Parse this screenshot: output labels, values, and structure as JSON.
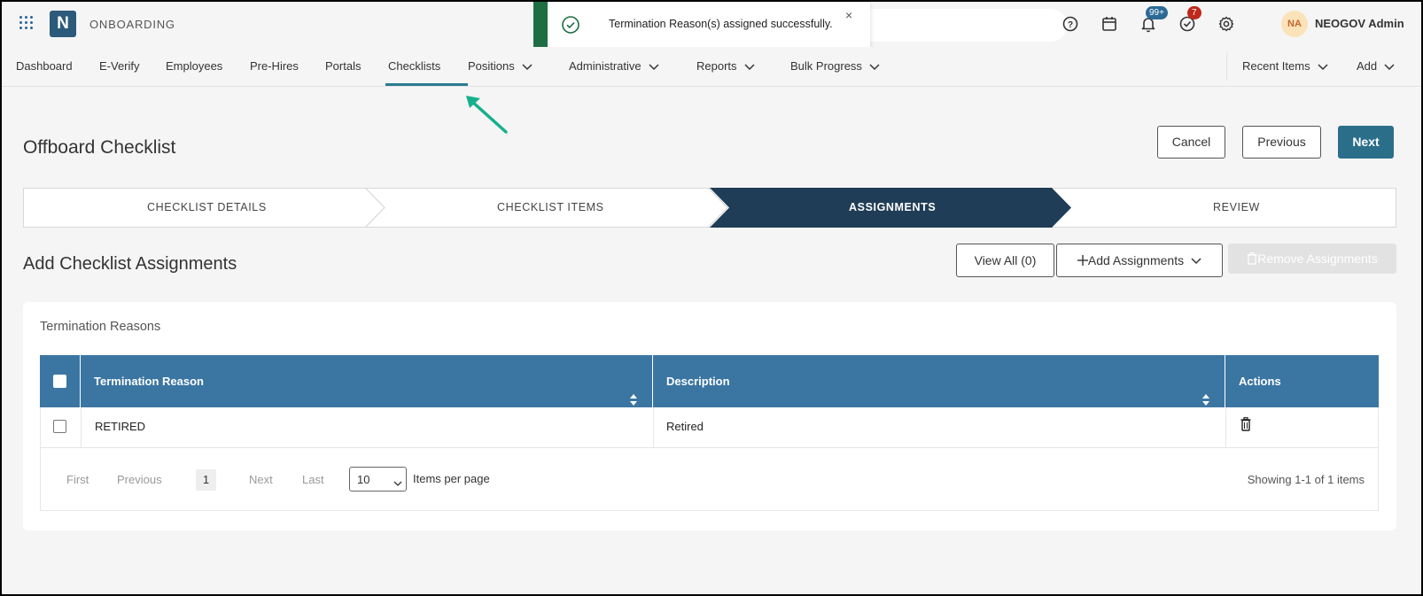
{
  "app": {
    "name": "ONBOARDING",
    "logo_letter": "N"
  },
  "header": {
    "notifications_badge": "99+",
    "tasks_badge": "7",
    "user_initials": "NA",
    "user_name": "NEOGOV Admin"
  },
  "toast": {
    "message": "Termination Reason(s) assigned successfully.",
    "close": "×"
  },
  "nav": {
    "items": [
      "Dashboard",
      "E-Verify",
      "Employees",
      "Pre-Hires",
      "Portals",
      "Checklists",
      "Positions",
      "Administrative",
      "Reports",
      "Bulk Progress"
    ],
    "active": "Checklists",
    "recent_items": "Recent Items",
    "add": "Add"
  },
  "page": {
    "title": "Offboard Checklist",
    "cancel": "Cancel",
    "previous": "Previous",
    "next": "Next"
  },
  "stepper": {
    "steps": [
      "CHECKLIST DETAILS",
      "CHECKLIST ITEMS",
      "ASSIGNMENTS",
      "REVIEW"
    ],
    "active_index": 2
  },
  "assignments": {
    "title": "Add Checklist Assignments",
    "view_all": "View All (0)",
    "add_assignments": "Add Assignments",
    "remove_assignments": "Remove Assignments"
  },
  "table": {
    "caption": "Termination Reasons",
    "columns": [
      "Termination Reason",
      "Description",
      "Actions"
    ],
    "rows": [
      {
        "reason": "RETIRED",
        "description": "Retired"
      }
    ]
  },
  "pagination": {
    "first": "First",
    "previous": "Previous",
    "current": "1",
    "next": "Next",
    "last": "Last",
    "per_page": "10",
    "per_page_label": "Items per page",
    "summary": "Showing 1-1 of 1 items"
  },
  "colors": {
    "primary": "#2b6e8a",
    "table_header": "#3b76a3",
    "step_active": "#1f3d56",
    "toast_accent": "#1e6e44",
    "annotation_arrow": "#17b08c"
  }
}
